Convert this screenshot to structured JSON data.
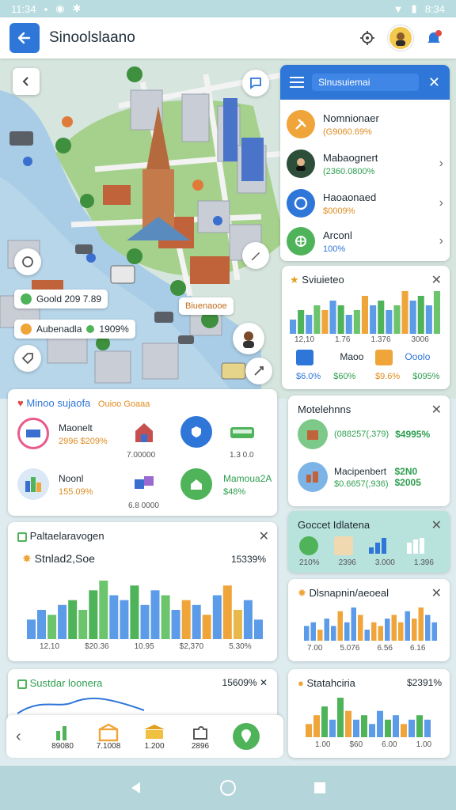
{
  "status": {
    "time": "11:34",
    "right_text": "8:34"
  },
  "appbar": {
    "title": "Sinoolslaano"
  },
  "map": {
    "pill_1": "Goold 209 7.89",
    "pill_2_name": "Aubenadla",
    "pill_2_value": "1909%",
    "pill_3": "Biuenaooe"
  },
  "side_menu": {
    "header": "Slnusuiemai",
    "items": [
      {
        "name": "Nomnionaer",
        "value": "(G9060.69%",
        "icon": "tools-icon"
      },
      {
        "name": "Mabaognert",
        "value": "(2360.0800%",
        "icon": "person-icon"
      },
      {
        "name": "Haoaonaed",
        "value": "$0009%",
        "icon": "target-icon"
      },
      {
        "name": "Arconl",
        "value": "100%",
        "icon": "globe-icon"
      }
    ]
  },
  "stats_panel": {
    "title": "Sviuieteo",
    "ticks": [
      "12,10",
      "1.76",
      "1.376",
      "3006"
    ],
    "items": [
      {
        "name": "Maoo",
        "a": "$6.0%",
        "b": "$60%"
      },
      {
        "name": "Ooolo",
        "a": "$9.6%",
        "b": "$095%"
      }
    ],
    "chart_values": [
      3,
      5,
      4,
      6,
      5,
      7,
      6,
      4,
      5,
      8,
      6,
      7,
      5,
      6,
      9,
      7,
      8,
      6,
      9
    ]
  },
  "mid_left_panel": {
    "title": "Minoo sujaofa",
    "subtitle": "Ouioo Goaaa",
    "items": [
      {
        "name": "Maonelt",
        "value": "2996 $209%",
        "caption": ""
      },
      {
        "name": "",
        "value": "",
        "caption": "7.00000"
      },
      {
        "name": "",
        "value": "",
        "caption": ""
      },
      {
        "name": "",
        "value": "",
        "caption": "1.3 0.0"
      },
      {
        "name": "Noonl",
        "value": "155.09%",
        "caption": ""
      },
      {
        "name": "",
        "value": "",
        "caption": "6.8 0000"
      },
      {
        "name": "Mamoua2A",
        "value": "$48%",
        "caption": ""
      }
    ]
  },
  "motel_panel": {
    "title": "Motelehnns",
    "rows": [
      {
        "text": "(088257(,379)",
        "value": "$4995%"
      },
      {
        "name": "Macipenbert",
        "text": "$0.6657(,936)",
        "value": "$2N0 $2005"
      }
    ]
  },
  "teal_panel": {
    "title": "Goccet Idlatena",
    "labels": [
      "210%",
      "2396",
      "3.000",
      "1.396"
    ]
  },
  "chart_panel": {
    "title": "Paltaelaravogen",
    "subtitle": "Stnlad2,Soe",
    "percent": "15339%",
    "ticks": [
      "12.10",
      "$20.36",
      "10.95",
      "$2,370",
      "5.30%"
    ],
    "values": [
      4,
      6,
      5,
      7,
      8,
      6,
      10,
      12,
      9,
      8,
      11,
      7,
      10,
      9,
      6,
      8,
      7,
      5,
      9,
      11,
      6,
      8,
      4
    ],
    "colors": [
      "#5b9be8",
      "#5b9be8",
      "#6cc46c",
      "#5b9be8",
      "#4fb35a",
      "#6cc46c",
      "#4fb35a",
      "#6cc46c",
      "#5b9be8",
      "#5b9be8",
      "#4fb35a",
      "#5b9be8",
      "#5b9be8",
      "#6cc46c",
      "#5b9be8",
      "#f0a53a",
      "#5b9be8",
      "#f0a53a",
      "#5b9be8",
      "#f0a53a",
      "#e8b84a",
      "#5b9be8",
      "#5b9be8"
    ]
  },
  "disc_panel": {
    "title": "Dlsnapnin/aeoeal",
    "ticks": [
      "7.00",
      "5.076",
      "6.56",
      "6.16"
    ],
    "values": [
      4,
      5,
      3,
      6,
      4,
      8,
      5,
      9,
      7,
      3,
      5,
      4,
      6,
      7,
      5,
      8,
      6,
      9,
      7,
      5
    ],
    "colors": [
      "#5b9be8",
      "#5b9be8",
      "#f0a53a",
      "#5b9be8",
      "#5b9be8",
      "#f0a53a",
      "#5b9be8",
      "#5b9be8",
      "#f0a53a",
      "#5b9be8",
      "#f0a53a",
      "#f0a53a",
      "#5b9be8",
      "#f0a53a",
      "#f0a53a",
      "#5b9be8",
      "#f0a53a",
      "#f0a53a",
      "#5b9be8",
      "#5b9be8"
    ]
  },
  "stat_panel": {
    "title": "Statahciria",
    "value": "$2391%",
    "ticks": [
      "1.00",
      "$60",
      "6.00",
      "1.00"
    ],
    "values": [
      3,
      5,
      7,
      4,
      9,
      6,
      4,
      5,
      3,
      6,
      4,
      5,
      3,
      4,
      5,
      4
    ],
    "colors": [
      "#f0a53a",
      "#f0a53a",
      "#4fb35a",
      "#5b9be8",
      "#4fb35a",
      "#f0a53a",
      "#5b9be8",
      "#4fb35a",
      "#5b9be8",
      "#5b9be8",
      "#4fb35a",
      "#5b9be8",
      "#f0a53a",
      "#5b9be8",
      "#4fb35a",
      "#5b9be8"
    ]
  },
  "sector_panel": {
    "title": "Sustdar loonera",
    "value": "15609%"
  },
  "bottom_nav": {
    "items": [
      {
        "label": "89080",
        "icon": "chart-icon"
      },
      {
        "label": "7.1008",
        "icon": "house-icon"
      },
      {
        "label": "1.200",
        "icon": "bank-icon"
      },
      {
        "label": "2896",
        "icon": "puzzle-icon"
      },
      {
        "label": "",
        "icon": "location-icon"
      }
    ]
  }
}
